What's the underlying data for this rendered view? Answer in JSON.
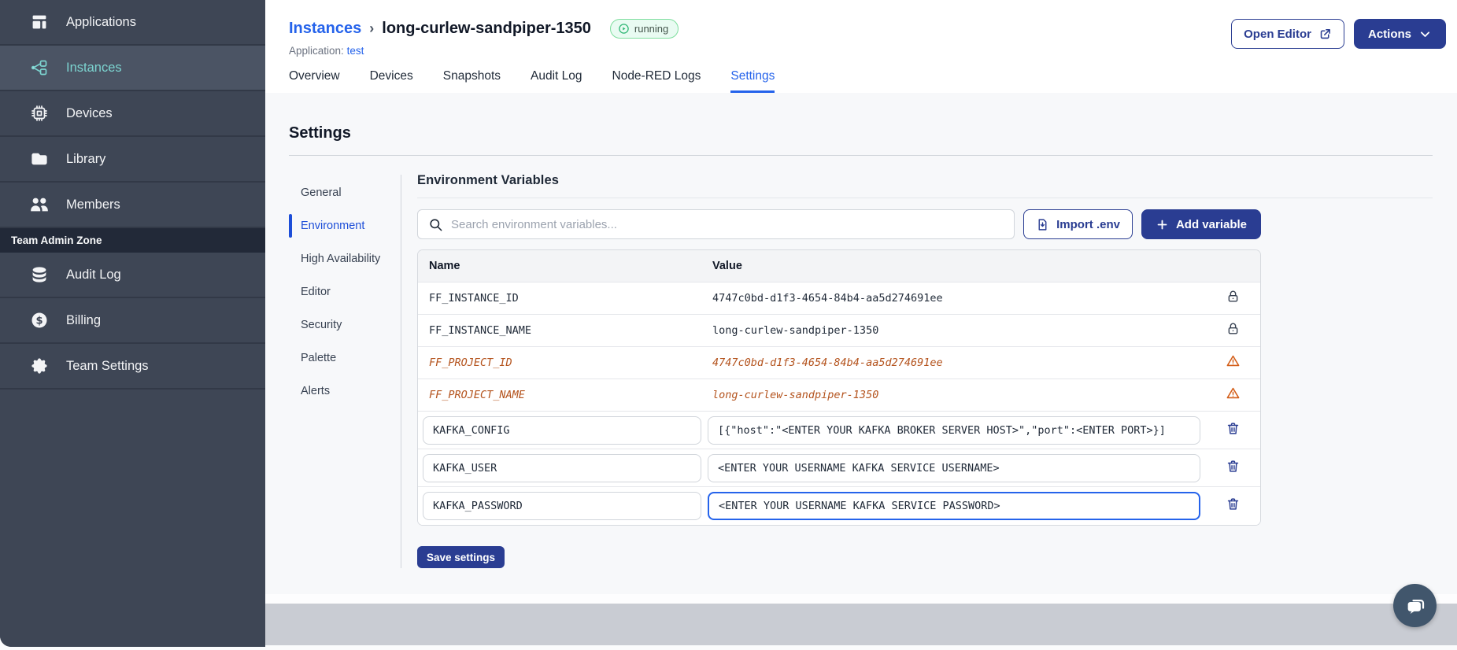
{
  "colors": {
    "navy": "#2a3d92",
    "link-blue": "#2563eb",
    "active-blue": "#1d4ed8",
    "teal": "#7cd4d0",
    "sidebar-bg": "#323947",
    "sidebar-item": "#3e4655",
    "sidebar-active": "#4b5464",
    "admin-zone-bg": "#222938",
    "badge-bg": "#e9fbf2",
    "badge-border": "#7ede9e",
    "status-green": "#2fb674",
    "warning-orange": "#d35d17",
    "deprecated-text": "#b4531d",
    "content-bg": "#f7f8fa",
    "footer-band": "#c9ccd3",
    "chat-bubble": "#41566c"
  },
  "sidebar": {
    "items": [
      {
        "label": "Applications",
        "icon": "applications",
        "active": false
      },
      {
        "label": "Instances",
        "icon": "instances",
        "active": true
      },
      {
        "label": "Devices",
        "icon": "devices",
        "active": false
      },
      {
        "label": "Library",
        "icon": "library",
        "active": false
      },
      {
        "label": "Members",
        "icon": "members",
        "active": false
      }
    ],
    "section_label": "Team Admin Zone",
    "admin_items": [
      {
        "label": "Audit Log",
        "icon": "audit-log",
        "active": false
      },
      {
        "label": "Billing",
        "icon": "billing",
        "active": false
      },
      {
        "label": "Team Settings",
        "icon": "team-settings",
        "active": false
      }
    ]
  },
  "header": {
    "breadcrumb_parent": "Instances",
    "breadcrumb_separator": "›",
    "instance_name": "long-curlew-sandpiper-1350",
    "status_badge": "running",
    "application_label": "Application:",
    "application_name": "test",
    "open_editor_label": "Open Editor",
    "actions_label": "Actions"
  },
  "tabs": [
    "Overview",
    "Devices",
    "Snapshots",
    "Audit Log",
    "Node-RED Logs",
    "Settings"
  ],
  "active_tab": "Settings",
  "settings": {
    "title": "Settings",
    "subnav": [
      "General",
      "Environment",
      "High Availability",
      "Editor",
      "Security",
      "Palette",
      "Alerts"
    ],
    "active_subnav": "Environment"
  },
  "environment": {
    "title": "Environment Variables",
    "search_placeholder": "Search environment variables...",
    "import_button": "Import .env",
    "add_button": "Add variable",
    "save_button": "Save settings",
    "table": {
      "columns": [
        "Name",
        "Value"
      ],
      "rows": [
        {
          "name": "FF_INSTANCE_ID",
          "value": "4747c0bd-d1f3-4654-84b4-aa5d274691ee",
          "type": "locked"
        },
        {
          "name": "FF_INSTANCE_NAME",
          "value": "long-curlew-sandpiper-1350",
          "type": "locked"
        },
        {
          "name": "FF_PROJECT_ID",
          "value": "4747c0bd-d1f3-4654-84b4-aa5d274691ee",
          "type": "deprecated"
        },
        {
          "name": "FF_PROJECT_NAME",
          "value": "long-curlew-sandpiper-1350",
          "type": "deprecated"
        },
        {
          "name": "KAFKA_CONFIG",
          "value": "[{\"host\":\"<ENTER YOUR KAFKA BROKER SERVER HOST>\",\"port\":<ENTER PORT>}]",
          "type": "editable",
          "focused": false
        },
        {
          "name": "KAFKA_USER",
          "value": "<ENTER YOUR USERNAME KAFKA SERVICE USERNAME>",
          "type": "editable",
          "focused": false
        },
        {
          "name": "KAFKA_PASSWORD",
          "value": "<ENTER YOUR USERNAME KAFKA SERVICE PASSWORD>",
          "type": "editable",
          "focused": true
        }
      ]
    }
  }
}
